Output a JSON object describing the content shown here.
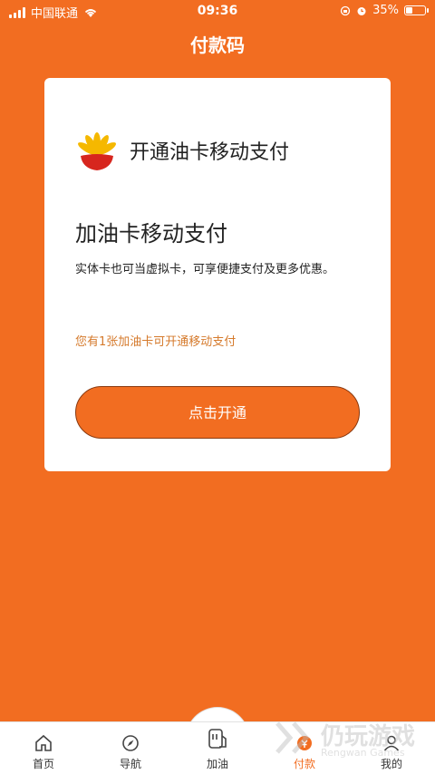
{
  "status_bar": {
    "carrier": "中国联通",
    "time": "09:36",
    "battery_percent_label": "35%",
    "battery_level": 0.35
  },
  "header": {
    "title": "付款码"
  },
  "card": {
    "brand_title": "开通油卡移动支付",
    "heading": "加油卡移动支付",
    "description": "实体卡也可当虚拟卡，可享便捷支付及更多优惠。",
    "note": "您有1张加油卡可开通移动支付",
    "button_label": "点击开通"
  },
  "tabbar": {
    "tabs": [
      {
        "label": "首页",
        "icon": "home-icon"
      },
      {
        "label": "导航",
        "icon": "compass-icon"
      },
      {
        "label": "加油",
        "icon": "fuel-card-icon"
      },
      {
        "label": "付款",
        "icon": "payment-icon",
        "active": true
      },
      {
        "label": "我的",
        "icon": "user-icon"
      }
    ]
  },
  "watermark": {
    "text": "仍玩游戏",
    "sub": "Rengwan Games"
  },
  "colors": {
    "accent": "#f26d21",
    "note": "#d57a2c"
  }
}
